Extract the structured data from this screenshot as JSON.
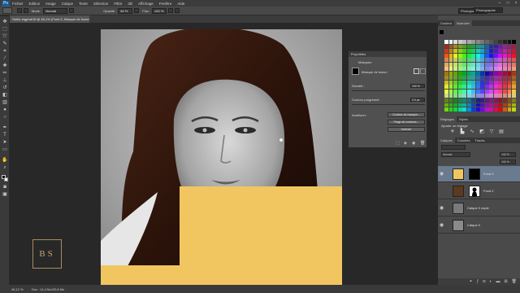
{
  "app": {
    "logo_text": "Ps"
  },
  "menu": [
    "Fichier",
    "Edition",
    "Image",
    "Calque",
    "Texte",
    "Sélection",
    "Filtre",
    "3D",
    "Affichage",
    "Fenêtre",
    "Aide"
  ],
  "window_controls": [
    "–",
    "□",
    "×"
  ],
  "options_bar": {
    "mode_label": "Mode :",
    "mode_value": "Normal",
    "opacity_label": "Opacité :",
    "opacity_value": "84 %",
    "flow_label": "Flux :",
    "flow_value": "100 %"
  },
  "workspace": "Photographie",
  "document_tab": "Sahlo-Ingphaf.tif @ 46,1% (Fond 3, Masque de fusion/8)",
  "properties": {
    "header": "Propriétés",
    "section": "Masques",
    "mask_label": "Masque de fusion",
    "density_label": "Densité :",
    "density_value": "100 %",
    "feather_label": "Contour progressif :",
    "feather_value": "0,0 px",
    "refine_label": "Améliorer :",
    "btn_edge": "Contour du masque...",
    "btn_color": "Plage de couleurs...",
    "btn_invert": "Inverser"
  },
  "right_panels": {
    "top_tabs": [
      "Couleur",
      "Nuancier"
    ],
    "adj_tabs": [
      "Réglages",
      "Styles"
    ],
    "adj_title": "Ajouter un réglage",
    "layers_tabs": [
      "Calques",
      "Couches",
      "Tracés"
    ],
    "blend_mode": "Normal",
    "opacity_value": "100 %",
    "fill_value": "100 %"
  },
  "layers": [
    {
      "name": "Fond 3",
      "selected": true
    },
    {
      "name": "Fond 2",
      "selected": false
    },
    {
      "name": "Calque 0 copie",
      "selected": false
    },
    {
      "name": "Calque 0",
      "selected": false
    }
  ],
  "logo": {
    "text": "BS"
  },
  "status": {
    "zoom": "46,12 %",
    "doc_info": "Doc : 14,4 Mo/32,8 Mo"
  },
  "colors": {
    "highlight_yellow": "#f1c661",
    "selection_blue": "#6a7a8f",
    "logo_gold": "#c7a36e"
  }
}
